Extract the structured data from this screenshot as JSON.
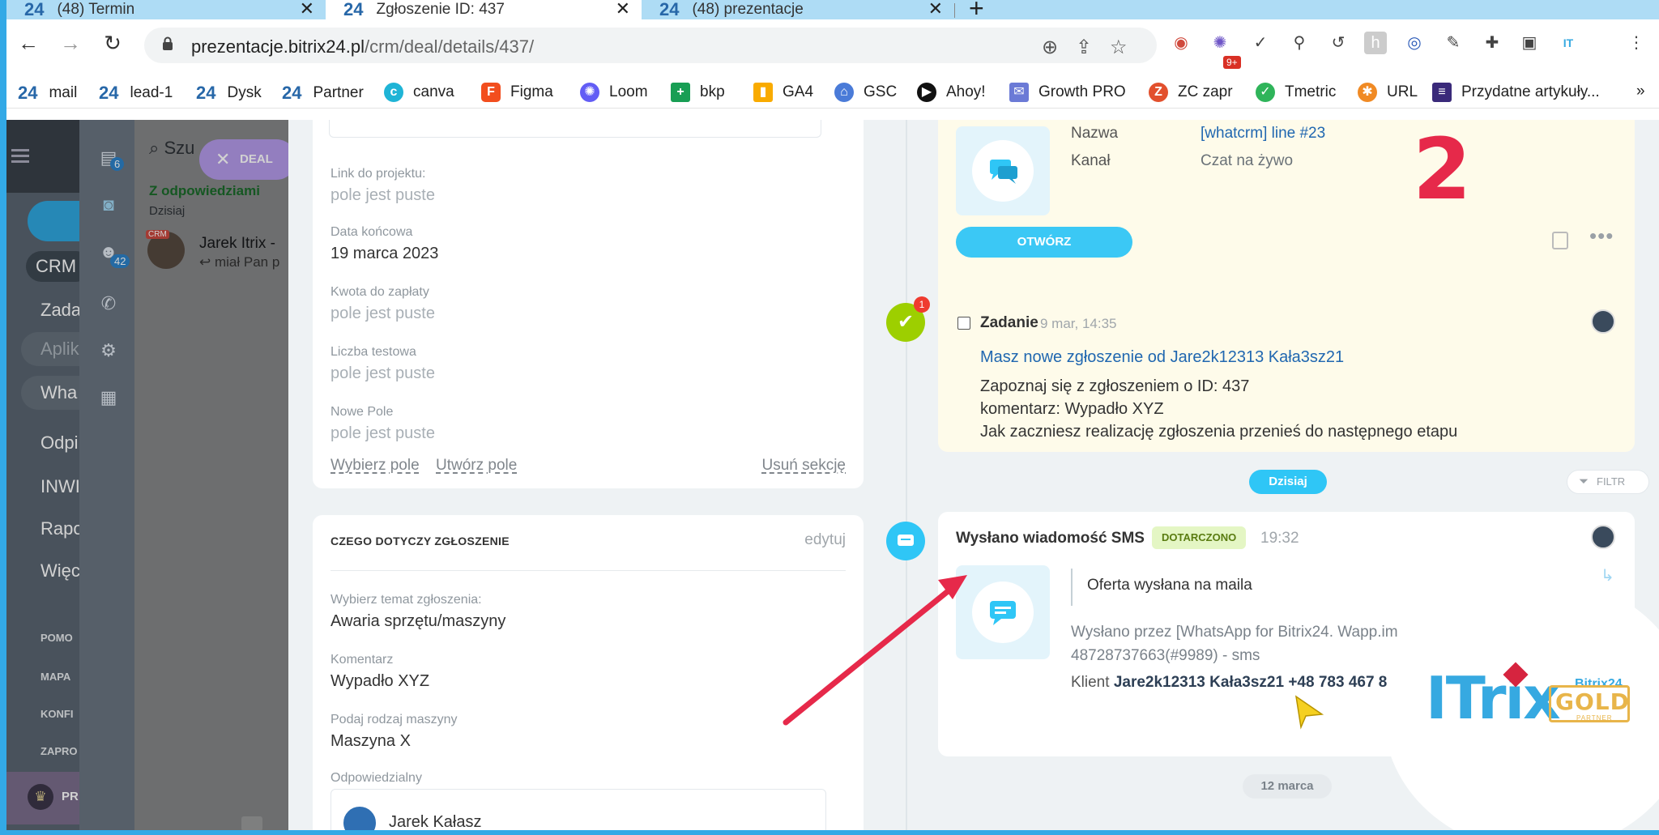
{
  "browser": {
    "tabs": [
      {
        "label": "(48) Termin",
        "active": false
      },
      {
        "label": "Zgłoszenie ID: 437",
        "active": true
      },
      {
        "label": "(48) prezentacje",
        "active": false
      }
    ],
    "tab_logo": "24",
    "new_tab_label": "+",
    "url_host": "prezentacje.bitrix24.pl",
    "url_path": "/crm/deal/details/437/",
    "extension_badge": "9+",
    "bookmarks": [
      {
        "label": "mail",
        "icon": "b24"
      },
      {
        "label": "lead-1",
        "icon": "b24"
      },
      {
        "label": "Dysk",
        "icon": "b24"
      },
      {
        "label": "Partner",
        "icon": "b24"
      },
      {
        "label": "canva",
        "icon": "canva"
      },
      {
        "label": "Figma",
        "icon": "figma"
      },
      {
        "label": "Loom",
        "icon": "loom"
      },
      {
        "label": "bkp",
        "icon": "bkp"
      },
      {
        "label": "GA4",
        "icon": "ga4"
      },
      {
        "label": "GSC",
        "icon": "gsc"
      },
      {
        "label": "Ahoy!",
        "icon": "ahoy"
      },
      {
        "label": "Growth PRO",
        "icon": "growth"
      },
      {
        "label": "ZC zapr",
        "icon": "zc"
      },
      {
        "label": "Tmetric",
        "icon": "tmetric"
      },
      {
        "label": "URL",
        "icon": "url"
      },
      {
        "label": "Przydatne artykuły...",
        "icon": "articles"
      }
    ],
    "bookmarks_more": "»"
  },
  "left_menu": {
    "crm": "CRM",
    "items": [
      "Zada",
      "Aplik",
      "Wha",
      "Odpi",
      "INWI",
      "Rapo",
      "Więc"
    ],
    "small_items": [
      "POMO",
      "MAPA",
      "KONFI",
      "ZAPRO"
    ],
    "bottom_label": "PR"
  },
  "chat_strip": {
    "badge_messages": "6",
    "badge_contacts": "42"
  },
  "chat_panel": {
    "search_placeholder": "Szu",
    "deal_chip": "DEAL",
    "group": "Z odpowiedziami",
    "day": "Dzisiaj",
    "crm_tag": "CRM",
    "contact_name": "Jarek Itrix -",
    "contact_preview": "miał Pan p"
  },
  "deal_form": {
    "fields_top": [
      {
        "label": "Link do projektu:",
        "value": "pole jest puste",
        "empty": true
      },
      {
        "label": "Data końcowa",
        "value": "19 marca 2023",
        "empty": false
      },
      {
        "label": "Kwota do zapłaty",
        "value": "pole jest puste",
        "empty": true
      },
      {
        "label": "Liczba testowa",
        "value": "pole jest puste",
        "empty": true
      },
      {
        "label": "Nowe Pole",
        "value": "pole jest puste",
        "empty": true
      }
    ],
    "select_field": "Wybierz pole",
    "create_field": "Utwórz pole",
    "delete_section": "Usuń sekcję",
    "section_title": "CZEGO DOTYCZY ZGŁOSZENIE",
    "section_edit": "edytuj",
    "fields_bottom": [
      {
        "label": "Wybierz temat zgłoszenia:",
        "value": "Awaria sprzętu/maszyny"
      },
      {
        "label": "Komentarz",
        "value": "Wypadło XYZ"
      },
      {
        "label": "Podaj rodzaj maszyny",
        "value": "Maszyna X"
      }
    ],
    "responsible_label": "Odpowiedzialny",
    "responsible_name": "Jarek Kałasz"
  },
  "timeline": {
    "chat": {
      "name_label": "Nazwa",
      "name_value": "[whatcrm] line #23",
      "channel_label": "Kanał",
      "channel_value": "Czat na żywo",
      "open_button": "OTWÓRZ"
    },
    "task": {
      "badge": "1",
      "title": "Zadanie",
      "date": "9 mar, 14:35",
      "link": "Masz nowe zgłoszenie od Jare2k12313 Kała3sz21",
      "lines": [
        "Zapoznaj się z zgłoszeniem o ID: 437",
        "komentarz: Wypadło XYZ",
        "Jak zaczniesz realizację zgłoszenia przenieś do następnego etapu"
      ]
    },
    "today_pill": "Dzisiaj",
    "filter_label": "FILTR",
    "sms": {
      "title": "Wysłano wiadomość SMS",
      "status": "DOTARCZONO",
      "time": "19:32",
      "quote": "Oferta wysłana na maila",
      "via_line1": "Wysłano przez [WhatsApp for Bitrix24. Wapp.im",
      "via_line2": "48728737663(#9989) - sms",
      "client_label": "Klient",
      "client_value": "Jare2k12313 Kała3sz21 +48 783 467 8"
    },
    "date_pill_old": "12 marca"
  },
  "overlay": {
    "step_number": "2",
    "logo_text": "ITrix",
    "logo_gold": "GOLD",
    "logo_b24": "Bitrix24",
    "logo_partner": "PARTNER"
  },
  "colors": {
    "accent_blue": "#2fc6f6",
    "task_green": "#9dcf00",
    "arrow_red": "#e6294a",
    "frame_blue": "#33a9e6"
  }
}
